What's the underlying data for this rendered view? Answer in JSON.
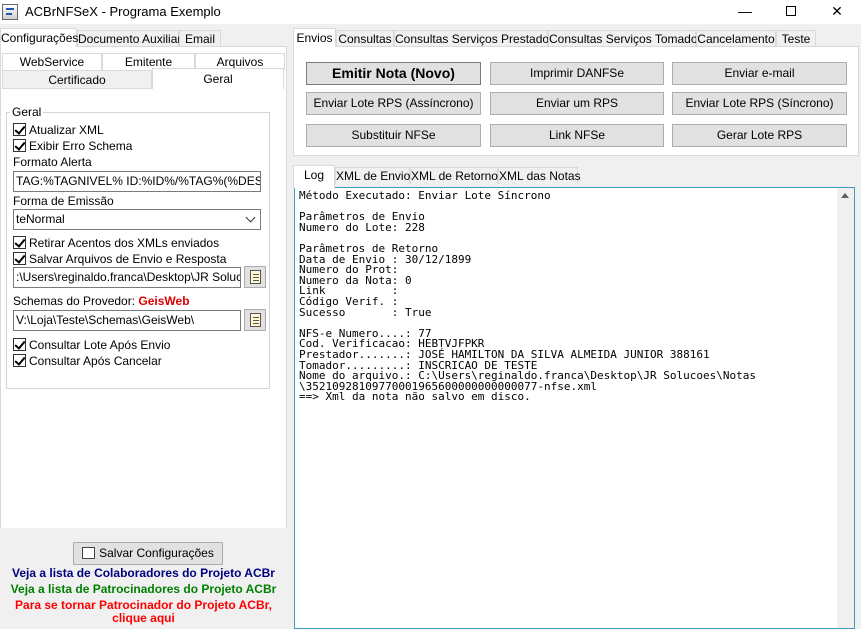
{
  "window": {
    "title": "ACBrNFSeX - Programa Exemplo",
    "minimize": "—",
    "close": "✕"
  },
  "left": {
    "tabs_top": [
      "Configurações",
      "Documento Auxiliar",
      "Email"
    ],
    "tabs_row1": [
      "WebService",
      "Emitente",
      "Arquivos"
    ],
    "tabs_row2": [
      "Certificado",
      "Geral"
    ],
    "group_label": "Geral",
    "atualizar_xml": "Atualizar XML",
    "exibir_erro": "Exibir Erro Schema",
    "formato_alerta_label": "Formato Alerta",
    "formato_alerta_value": "TAG:%TAGNIVEL% ID:%ID%/%TAG%(%DESCRI",
    "forma_emissao_label": "Forma de Emissão",
    "forma_emissao_value": "teNormal",
    "retirar_acentos": "Retirar Acentos dos XMLs enviados",
    "salvar_arquivos": "Salvar Arquivos de Envio e Resposta",
    "path_value": ":\\Users\\reginaldo.franca\\Desktop\\JR Solucoes",
    "schemas_label": "Schemas do Provedor:",
    "schemas_provider": "GeisWeb",
    "schemas_value": "V:\\Loja\\Teste\\Schemas\\GeisWeb\\",
    "consultar_lote": "Consultar Lote Após Envio",
    "consultar_cancelar": "Consultar Após Cancelar",
    "salvar_config": "Salvar Configurações",
    "link_colaboradores": "Veja a lista de Colaboradores do Projeto ACBr",
    "link_patrocinadores": "Veja a lista de Patrocinadores do Projeto ACBr",
    "link_tornar_1": "Para se tornar Patrocinador do Projeto ACBr,",
    "link_tornar_2": "clique aqui"
  },
  "right": {
    "tabs": [
      "Envios",
      "Consultas",
      "Consultas Serviços Prestados",
      "Consultas Serviços Tomados",
      "Cancelamento",
      "Teste"
    ],
    "buttons": {
      "emitir_nota": "Emitir Nota (Novo)",
      "imprimir_danfse": "Imprimir DANFSe",
      "enviar_email": "Enviar e-mail",
      "enviar_lote_assincrono": "Enviar Lote RPS (Assíncrono)",
      "enviar_um_rps": "Enviar um RPS",
      "enviar_lote_sincrono": "Enviar Lote RPS (Síncrono)",
      "substituir_nfse": "Substituir NFSe",
      "link_nfse": "Link NFSe",
      "gerar_lote_rps": "Gerar Lote RPS"
    },
    "log_tabs": [
      "Log",
      "XML de Envio",
      "XML de Retorno",
      "XML das Notas"
    ],
    "log_lines": [
      "Método Executado: Enviar Lote Síncrono",
      "",
      "Parâmetros de Envio",
      "Numero do Lote: 228",
      "",
      "Parâmetros de Retorno",
      "Data de Envio : 30/12/1899",
      "Numero do Prot:",
      "Numero da Nota: 0",
      "Link          :",
      "Código Verif. :",
      "Sucesso       : True",
      "",
      "NFS-e Numero....: 77",
      "Cod. Verificacao: HEBTVJFPKR",
      "Prestador.......: JOSÉ HAMILTON DA SILVA ALMEIDA JUNIOR 388161",
      "Tomador.........: INSCRICAO DE TESTE",
      "Nome do arquivo.: C:\\Users\\reginaldo.franca\\Desktop\\JR Solucoes\\Notas",
      "\\35210928109770001965600000000000077-nfse.xml",
      "==> Xml da nota não salvo em disco."
    ]
  },
  "colors": {
    "provider_red": "#e00000",
    "link_navy": "#000080",
    "link_green": "#008000",
    "link_red": "#ff0000",
    "log_border": "#3c9bb8"
  }
}
